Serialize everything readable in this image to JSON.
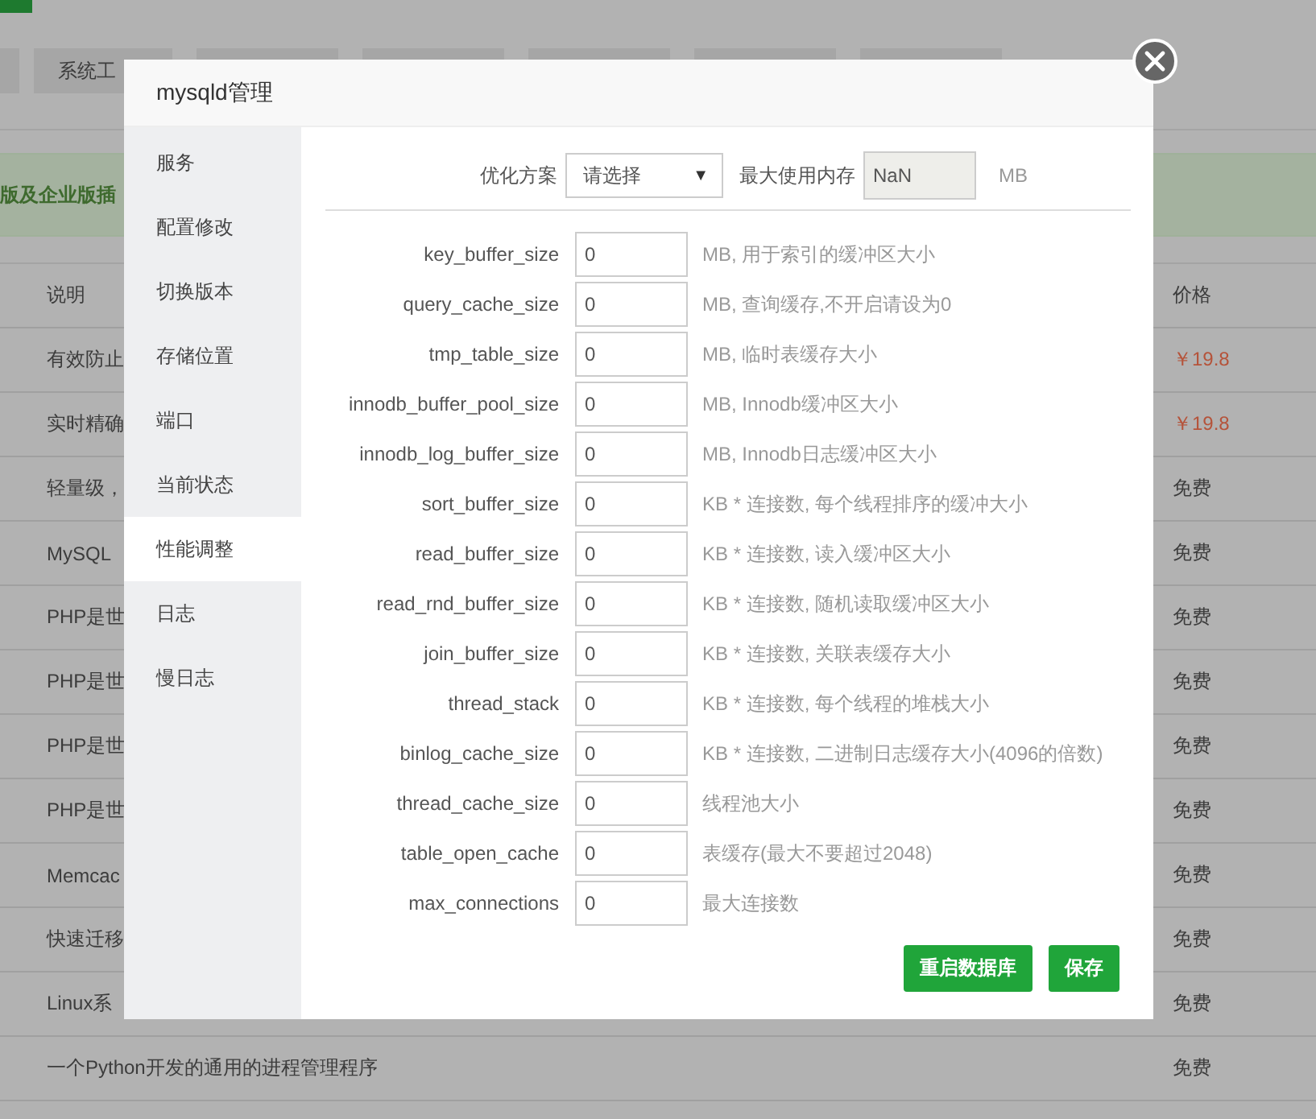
{
  "background": {
    "tabs": [
      {
        "label": "系统工"
      }
    ],
    "banner": "版及企业版插",
    "table": {
      "columns": [
        "说明",
        "价格"
      ],
      "rows": [
        {
          "description": "有效防止",
          "price": "￥19.8",
          "kind": "paid"
        },
        {
          "description": "实时精确",
          "price": "￥19.8",
          "kind": "paid"
        },
        {
          "description": "轻量级，",
          "price": "免费",
          "kind": "free"
        },
        {
          "description": "MySQL",
          "price": "免费",
          "kind": "free"
        },
        {
          "description": "PHP是世",
          "price": "免费",
          "kind": "free"
        },
        {
          "description": "PHP是世",
          "price": "免费",
          "kind": "free"
        },
        {
          "description": "PHP是世",
          "price": "免费",
          "kind": "free"
        },
        {
          "description": "PHP是世",
          "price": "免费",
          "kind": "free"
        },
        {
          "description": "Memcac",
          "price": "免费",
          "kind": "free"
        },
        {
          "description": "快速迁移",
          "price": "免费",
          "kind": "free"
        },
        {
          "description": "Linux系",
          "price": "免费",
          "kind": "free"
        },
        {
          "description": "一个Python开发的通用的进程管理程序",
          "price": "免费",
          "kind": "free"
        }
      ]
    }
  },
  "dialog": {
    "title": "mysqld管理",
    "menu": [
      {
        "label": "服务",
        "selected": false
      },
      {
        "label": "配置修改",
        "selected": false
      },
      {
        "label": "切换版本",
        "selected": false
      },
      {
        "label": "存储位置",
        "selected": false
      },
      {
        "label": "端口",
        "selected": false
      },
      {
        "label": "当前状态",
        "selected": false
      },
      {
        "label": "性能调整",
        "selected": true
      },
      {
        "label": "日志",
        "selected": false
      },
      {
        "label": "慢日志",
        "selected": false
      }
    ],
    "optimize": {
      "label": "优化方案",
      "select": "请选择",
      "arrow": "▼",
      "memory_label": "最大使用内存",
      "memory_value": "NaN",
      "memory_disabled": true,
      "unit": "MB"
    },
    "params": [
      {
        "name": "key_buffer_size",
        "value": "0",
        "hint": "MB, 用于索引的缓冲区大小"
      },
      {
        "name": "query_cache_size",
        "value": "0",
        "hint": "MB, 查询缓存,不开启请设为0"
      },
      {
        "name": "tmp_table_size",
        "value": "0",
        "hint": "MB, 临时表缓存大小"
      },
      {
        "name": "innodb_buffer_pool_size",
        "value": "0",
        "hint": "MB, Innodb缓冲区大小"
      },
      {
        "name": "innodb_log_buffer_size",
        "value": "0",
        "hint": "MB, Innodb日志缓冲区大小"
      },
      {
        "name": "sort_buffer_size",
        "value": "0",
        "hint": "KB * 连接数, 每个线程排序的缓冲大小"
      },
      {
        "name": "read_buffer_size",
        "value": "0",
        "hint": "KB * 连接数, 读入缓冲区大小"
      },
      {
        "name": "read_rnd_buffer_size",
        "value": "0",
        "hint": "KB * 连接数, 随机读取缓冲区大小"
      },
      {
        "name": "join_buffer_size",
        "value": "0",
        "hint": "KB * 连接数, 关联表缓存大小"
      },
      {
        "name": "thread_stack",
        "value": "0",
        "hint": "KB * 连接数, 每个线程的堆栈大小"
      },
      {
        "name": "binlog_cache_size",
        "value": "0",
        "hint": "KB * 连接数, 二进制日志缓存大小(4096的倍数)"
      },
      {
        "name": "thread_cache_size",
        "value": "0",
        "hint": "线程池大小"
      },
      {
        "name": "table_open_cache",
        "value": "0",
        "hint": "表缓存(最大不要超过2048)"
      },
      {
        "name": "max_connections",
        "value": "0",
        "hint": "最大连接数"
      }
    ],
    "buttons": [
      "重启数据库",
      "保存"
    ]
  }
}
